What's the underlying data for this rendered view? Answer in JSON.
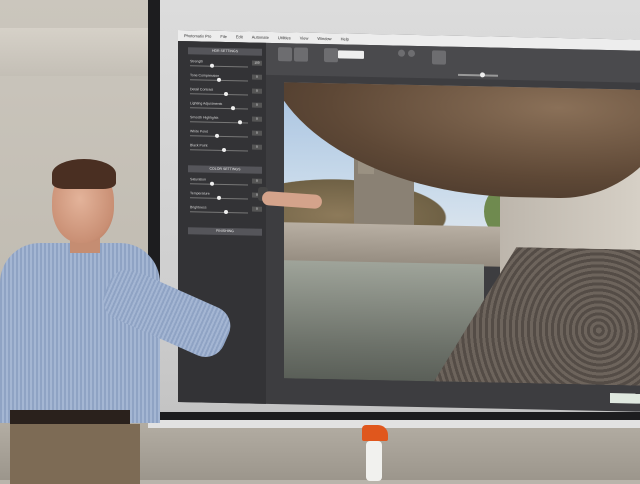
{
  "app": {
    "menu": [
      "Photomatix Pro",
      "File",
      "Edit",
      "Automate",
      "Utilities",
      "View",
      "Window",
      "Help"
    ],
    "sidebar": {
      "panels": [
        {
          "header": "HDR SETTINGS",
          "rows": [
            {
              "label": "Strength",
              "value": "100"
            },
            {
              "label": "Tone Compression",
              "value": "0"
            },
            {
              "label": "Detail Contrast",
              "value": "0"
            },
            {
              "label": "Lighting Adjustments",
              "value": "0"
            },
            {
              "label": "Smooth Highlights",
              "value": "0"
            },
            {
              "label": "White Point",
              "value": "0"
            },
            {
              "label": "Black Point",
              "value": "0"
            }
          ]
        },
        {
          "header": "COLOR SETTINGS",
          "rows": [
            {
              "label": "Saturation",
              "value": "0"
            },
            {
              "label": "Temperature",
              "value": "0"
            },
            {
              "label": "Brightness",
              "value": "0"
            }
          ]
        },
        {
          "header": "FINISHING",
          "rows": []
        }
      ]
    },
    "status_label": ""
  },
  "colors": {
    "screen_frame": "#1d1d1f",
    "app_bg": "#3d3d40",
    "shirt": "#a4b6d3",
    "spray_nozzle": "#e0571d"
  }
}
